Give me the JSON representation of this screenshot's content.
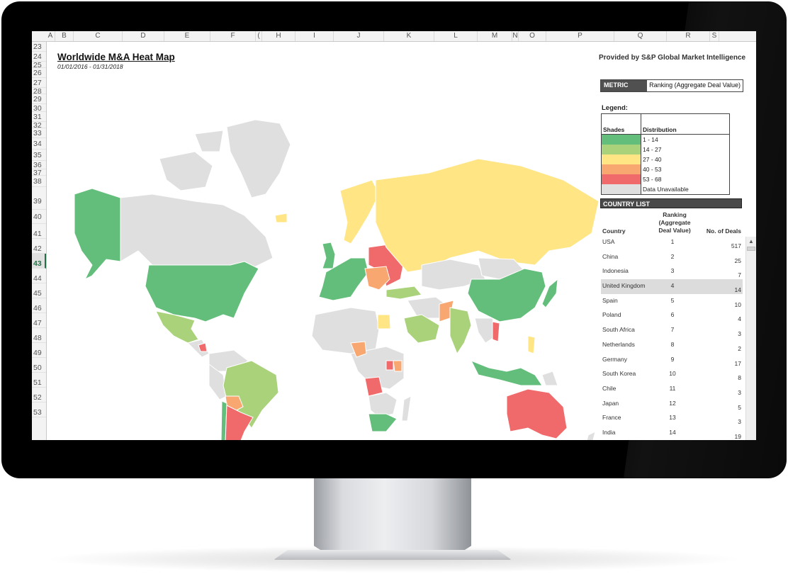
{
  "spreadsheet": {
    "columns": [
      "A",
      "B",
      "C",
      "D",
      "E",
      "F",
      "(",
      "H",
      "I",
      "J",
      "K",
      "L",
      "M",
      "N",
      "O",
      "P",
      "Q",
      "R",
      "S"
    ],
    "rows": [
      "23",
      "24",
      "25",
      "26",
      "27",
      "28",
      "29",
      "30",
      "31",
      "32",
      "33",
      "34",
      "35",
      "36",
      "37",
      "38",
      "39",
      "40",
      "41",
      "42",
      "43",
      "44",
      "45",
      "46",
      "47",
      "48",
      "49",
      "50",
      "51",
      "52",
      "53"
    ],
    "selected_row": "43"
  },
  "report": {
    "title": "Worldwide M&A Heat Map",
    "date_range": "01/01/2016 - 01/31/2018",
    "provider": "Provided by S&P Global Market Intelligence"
  },
  "metric": {
    "label": "METRIC",
    "value": "Ranking (Aggregate Deal Value)"
  },
  "legend": {
    "title": "Legend:",
    "col_shades": "Shades",
    "col_distribution": "Distribution",
    "items": [
      {
        "range": "1 - 14",
        "color": "#63be7b"
      },
      {
        "range": "14 - 27",
        "color": "#a9d27a"
      },
      {
        "range": "27 - 40",
        "color": "#ffe584"
      },
      {
        "range": "40 - 53",
        "color": "#f8a771"
      },
      {
        "range": "53 - 68",
        "color": "#f06a6b"
      },
      {
        "range": "Data Unavailable",
        "color": "#dfdfdf"
      }
    ]
  },
  "country_list": {
    "header": "COUNTRY LIST",
    "col_country": "Country",
    "col_ranking": "Ranking (Aggregate Deal Value)",
    "col_ranking_lines": [
      "Ranking",
      "(Aggregate",
      "Deal Value)"
    ],
    "col_deals": "No. of Deals",
    "highlighted": "United Kingdom",
    "rows": [
      {
        "country": "USA",
        "rank": "1",
        "deals": "517"
      },
      {
        "country": "China",
        "rank": "2",
        "deals": "25"
      },
      {
        "country": "Indonesia",
        "rank": "3",
        "deals": "7"
      },
      {
        "country": "United Kingdom",
        "rank": "4",
        "deals": "14"
      },
      {
        "country": "Spain",
        "rank": "5",
        "deals": "10"
      },
      {
        "country": "Poland",
        "rank": "6",
        "deals": "4"
      },
      {
        "country": "South Africa",
        "rank": "7",
        "deals": "3"
      },
      {
        "country": "Netherlands",
        "rank": "8",
        "deals": "2"
      },
      {
        "country": "Germany",
        "rank": "9",
        "deals": "17"
      },
      {
        "country": "South Korea",
        "rank": "10",
        "deals": "8"
      },
      {
        "country": "Chile",
        "rank": "11",
        "deals": "3"
      },
      {
        "country": "Japan",
        "rank": "12",
        "deals": "5"
      },
      {
        "country": "France",
        "rank": "13",
        "deals": "3"
      },
      {
        "country": "India",
        "rank": "14",
        "deals": "19"
      }
    ]
  },
  "map_regions": [
    {
      "name": "alaska",
      "color": "#63be7b"
    },
    {
      "name": "canada",
      "color": "#dfdfdf"
    },
    {
      "name": "greenland",
      "color": "#dfdfdf"
    },
    {
      "name": "arctic-islands",
      "color": "#dfdfdf"
    },
    {
      "name": "usa",
      "color": "#63be7b"
    },
    {
      "name": "mexico",
      "color": "#a9d27a"
    },
    {
      "name": "central-america",
      "color": "#dfdfdf"
    },
    {
      "name": "nicaragua",
      "color": "#f06a6b"
    },
    {
      "name": "colombia-venezuela",
      "color": "#dfdfdf"
    },
    {
      "name": "peru",
      "color": "#dfdfdf"
    },
    {
      "name": "brazil",
      "color": "#a9d27a"
    },
    {
      "name": "bolivia",
      "color": "#f8a771"
    },
    {
      "name": "chile",
      "color": "#63be7b"
    },
    {
      "name": "argentina",
      "color": "#f06a6b"
    },
    {
      "name": "iceland",
      "color": "#ffe584"
    },
    {
      "name": "scandinavia",
      "color": "#ffe584"
    },
    {
      "name": "uk",
      "color": "#63be7b"
    },
    {
      "name": "western-europe",
      "color": "#63be7b"
    },
    {
      "name": "eastern-europe",
      "color": "#f06a6b"
    },
    {
      "name": "central-europe",
      "color": "#f8a771"
    },
    {
      "name": "russia",
      "color": "#ffe584"
    },
    {
      "name": "turkey",
      "color": "#a9d27a"
    },
    {
      "name": "central-asia",
      "color": "#dfdfdf"
    },
    {
      "name": "mongolia",
      "color": "#dfdfdf"
    },
    {
      "name": "china",
      "color": "#63be7b"
    },
    {
      "name": "japan",
      "color": "#63be7b"
    },
    {
      "name": "middle-east",
      "color": "#dfdfdf"
    },
    {
      "name": "saudi-arabia",
      "color": "#a9d27a"
    },
    {
      "name": "pakistan",
      "color": "#f8a771"
    },
    {
      "name": "india",
      "color": "#a9d27a"
    },
    {
      "name": "southeast-asia",
      "color": "#dfdfdf"
    },
    {
      "name": "vietnam",
      "color": "#f06a6b"
    },
    {
      "name": "indonesia",
      "color": "#63be7b"
    },
    {
      "name": "philippines",
      "color": "#ffe584"
    },
    {
      "name": "papua",
      "color": "#dfdfdf"
    },
    {
      "name": "australia",
      "color": "#f06a6b"
    },
    {
      "name": "new-zealand",
      "color": "#dfdfdf"
    },
    {
      "name": "north-africa",
      "color": "#dfdfdf"
    },
    {
      "name": "egypt",
      "color": "#ffe584"
    },
    {
      "name": "central-africa",
      "color": "#dfdfdf"
    },
    {
      "name": "nigeria",
      "color": "#f8a771"
    },
    {
      "name": "kenya",
      "color": "#f8a771"
    },
    {
      "name": "uganda",
      "color": "#f06a6b"
    },
    {
      "name": "angola",
      "color": "#f06a6b"
    },
    {
      "name": "southern-africa",
      "color": "#dfdfdf"
    },
    {
      "name": "south-africa",
      "color": "#63be7b"
    },
    {
      "name": "madagascar",
      "color": "#dfdfdf"
    }
  ]
}
